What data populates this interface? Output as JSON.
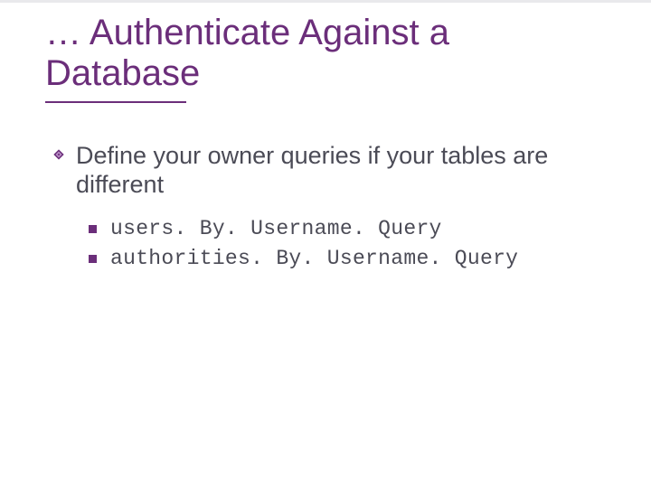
{
  "title": "… Authenticate Against a Database",
  "bullets": {
    "l1": "Define your owner queries if your tables are different",
    "l2": [
      "users. By. Username. Query",
      "authorities. By. Username. Query"
    ]
  },
  "colors": {
    "accent": "#6b2e7a",
    "text": "#4b4b56"
  }
}
